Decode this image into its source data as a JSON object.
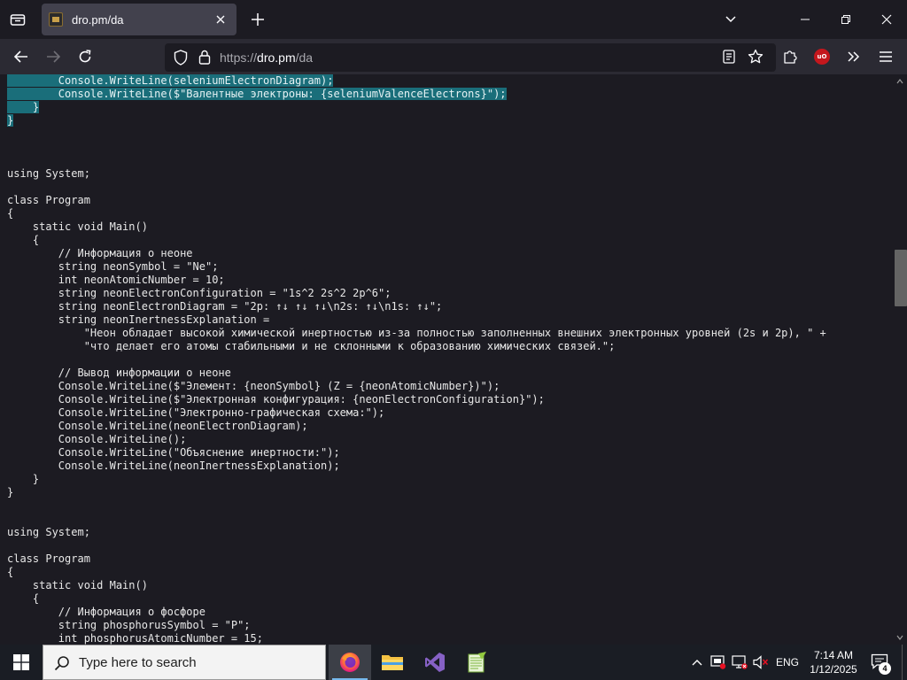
{
  "browser": {
    "tab": {
      "title": "dro.pm/da"
    },
    "url": {
      "proto": "https://",
      "host": "dro.pm",
      "path": "/da"
    }
  },
  "code_lines": [
    {
      "text": "        Console.WriteLine(seleniumElectronDiagram);",
      "sel": true
    },
    {
      "text": "        Console.WriteLine($\"Валентные электроны: {seleniumValenceElectrons}\");",
      "sel": true
    },
    {
      "text": "    }",
      "sel": true
    },
    {
      "text": "}",
      "sel": true
    },
    {
      "text": "",
      "sel": false
    },
    {
      "text": "",
      "sel": false
    },
    {
      "text": "",
      "sel": false
    },
    {
      "text": "using System;",
      "sel": false
    },
    {
      "text": "",
      "sel": false
    },
    {
      "text": "class Program",
      "sel": false
    },
    {
      "text": "{",
      "sel": false
    },
    {
      "text": "    static void Main()",
      "sel": false
    },
    {
      "text": "    {",
      "sel": false
    },
    {
      "text": "        // Информация о неоне",
      "sel": false
    },
    {
      "text": "        string neonSymbol = \"Ne\";",
      "sel": false
    },
    {
      "text": "        int neonAtomicNumber = 10;",
      "sel": false
    },
    {
      "text": "        string neonElectronConfiguration = \"1s^2 2s^2 2p^6\";",
      "sel": false
    },
    {
      "text": "        string neonElectronDiagram = \"2p: ↑↓ ↑↓ ↑↓\\n2s: ↑↓\\n1s: ↑↓\";",
      "sel": false
    },
    {
      "text": "        string neonInertnessExplanation =",
      "sel": false
    },
    {
      "text": "            \"Неон обладает высокой химической инертностью из-за полностью заполненных внешних электронных уровней (2s и 2p), \" +",
      "sel": false
    },
    {
      "text": "            \"что делает его атомы стабильными и не склонными к образованию химических связей.\";",
      "sel": false
    },
    {
      "text": "",
      "sel": false
    },
    {
      "text": "        // Вывод информации о неоне",
      "sel": false
    },
    {
      "text": "        Console.WriteLine($\"Элемент: {neonSymbol} (Z = {neonAtomicNumber})\");",
      "sel": false
    },
    {
      "text": "        Console.WriteLine($\"Электронная конфигурация: {neonElectronConfiguration}\");",
      "sel": false
    },
    {
      "text": "        Console.WriteLine(\"Электронно-графическая схема:\");",
      "sel": false
    },
    {
      "text": "        Console.WriteLine(neonElectronDiagram);",
      "sel": false
    },
    {
      "text": "        Console.WriteLine();",
      "sel": false
    },
    {
      "text": "        Console.WriteLine(\"Объяснение инертности:\");",
      "sel": false
    },
    {
      "text": "        Console.WriteLine(neonInertnessExplanation);",
      "sel": false
    },
    {
      "text": "    }",
      "sel": false
    },
    {
      "text": "}",
      "sel": false
    },
    {
      "text": "",
      "sel": false
    },
    {
      "text": "",
      "sel": false
    },
    {
      "text": "using System;",
      "sel": false
    },
    {
      "text": "",
      "sel": false
    },
    {
      "text": "class Program",
      "sel": false
    },
    {
      "text": "{",
      "sel": false
    },
    {
      "text": "    static void Main()",
      "sel": false
    },
    {
      "text": "    {",
      "sel": false
    },
    {
      "text": "        // Информация о фосфоре",
      "sel": false
    },
    {
      "text": "        string phosphorusSymbol = \"P\";",
      "sel": false
    },
    {
      "text": "        int phosphorusAtomicNumber = 15;",
      "sel": false
    }
  ],
  "taskbar": {
    "search_placeholder": "Type here to search",
    "language": "ENG",
    "time": "7:14 AM",
    "date": "1/12/2025",
    "notification_count": "4"
  },
  "colors": {
    "selection": "#1a6e7a",
    "page_bg": "#1c1b22",
    "tab_active": "#42414d"
  }
}
